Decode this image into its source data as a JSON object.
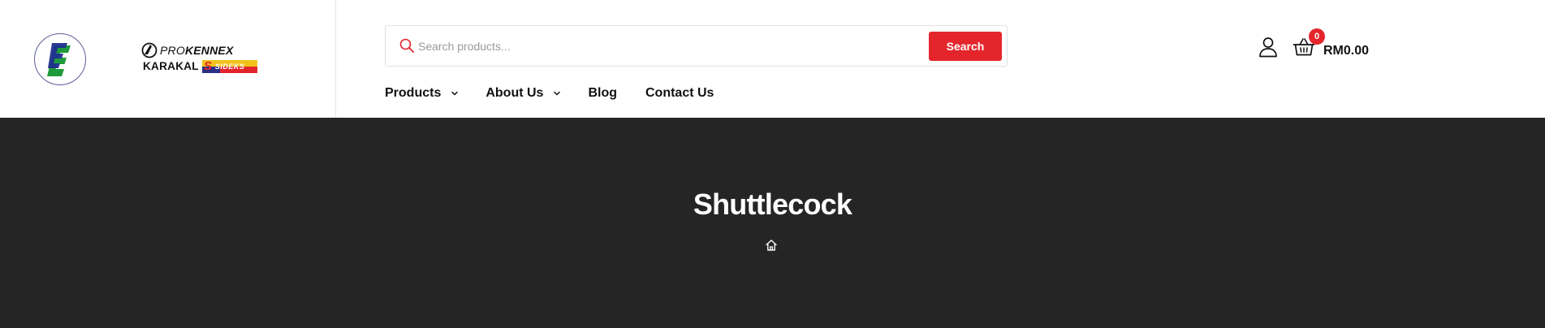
{
  "header": {
    "logos": {
      "site_logo": "E-logo",
      "partner_brands": {
        "prokennex": {
          "prefix": "PRO",
          "name": "KENNEX"
        },
        "karakal": "KARAKAL",
        "sideks": {
          "mark": "S",
          "name": "SIDEKS"
        }
      }
    },
    "search": {
      "placeholder": "Search products...",
      "button_label": "Search",
      "icon": "search-icon"
    },
    "nav": {
      "items": [
        {
          "label": "Products",
          "has_dropdown": true
        },
        {
          "label": "About Us",
          "has_dropdown": true
        },
        {
          "label": "Blog",
          "has_dropdown": false
        },
        {
          "label": "Contact Us",
          "has_dropdown": false
        }
      ]
    },
    "account": {
      "icon": "user-icon"
    },
    "cart": {
      "icon": "basket-icon",
      "count": "0",
      "total": "RM0.00"
    }
  },
  "hero": {
    "title": "Shuttlecock",
    "breadcrumb": {
      "home_icon": "home-icon"
    }
  },
  "colors": {
    "accent": "#e4262c",
    "hero_bg": "#252525",
    "text": "#111111"
  }
}
